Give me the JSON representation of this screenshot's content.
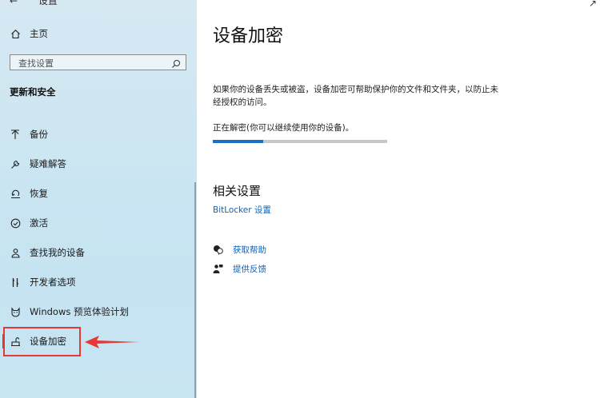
{
  "sidebar": {
    "back_label": "设置",
    "home_label": "主页",
    "search_placeholder": "查找设置",
    "section_title": "更新和安全",
    "items": [
      {
        "label": "备份",
        "icon": "backup-icon"
      },
      {
        "label": "疑难解答",
        "icon": "wrench-icon"
      },
      {
        "label": "恢复",
        "icon": "recovery-icon"
      },
      {
        "label": "激活",
        "icon": "activation-check-icon"
      },
      {
        "label": "查找我的设备",
        "icon": "find-device-icon"
      },
      {
        "label": "开发者选项",
        "icon": "developer-icon"
      },
      {
        "label": "Windows 预览体验计划",
        "icon": "insider-cat-icon"
      },
      {
        "label": "设备加密",
        "icon": "device-encryption-icon",
        "selected": true
      }
    ]
  },
  "main": {
    "title": "设备加密",
    "description": "如果你的设备丢失或被盗，设备加密可帮助保护你的文件和文件夹，以防止未经授权的访问。",
    "status": "正在解密(你可以继续使用你的设备)。",
    "progress": 0.29,
    "related_title": "相关设置",
    "bitlocker_link": "BitLocker 设置",
    "help_link": "获取帮助",
    "feedback_link": "提供反馈"
  },
  "colors": {
    "accent": "#1a6fc4",
    "link": "#1163b8",
    "highlight": "#e53935"
  }
}
